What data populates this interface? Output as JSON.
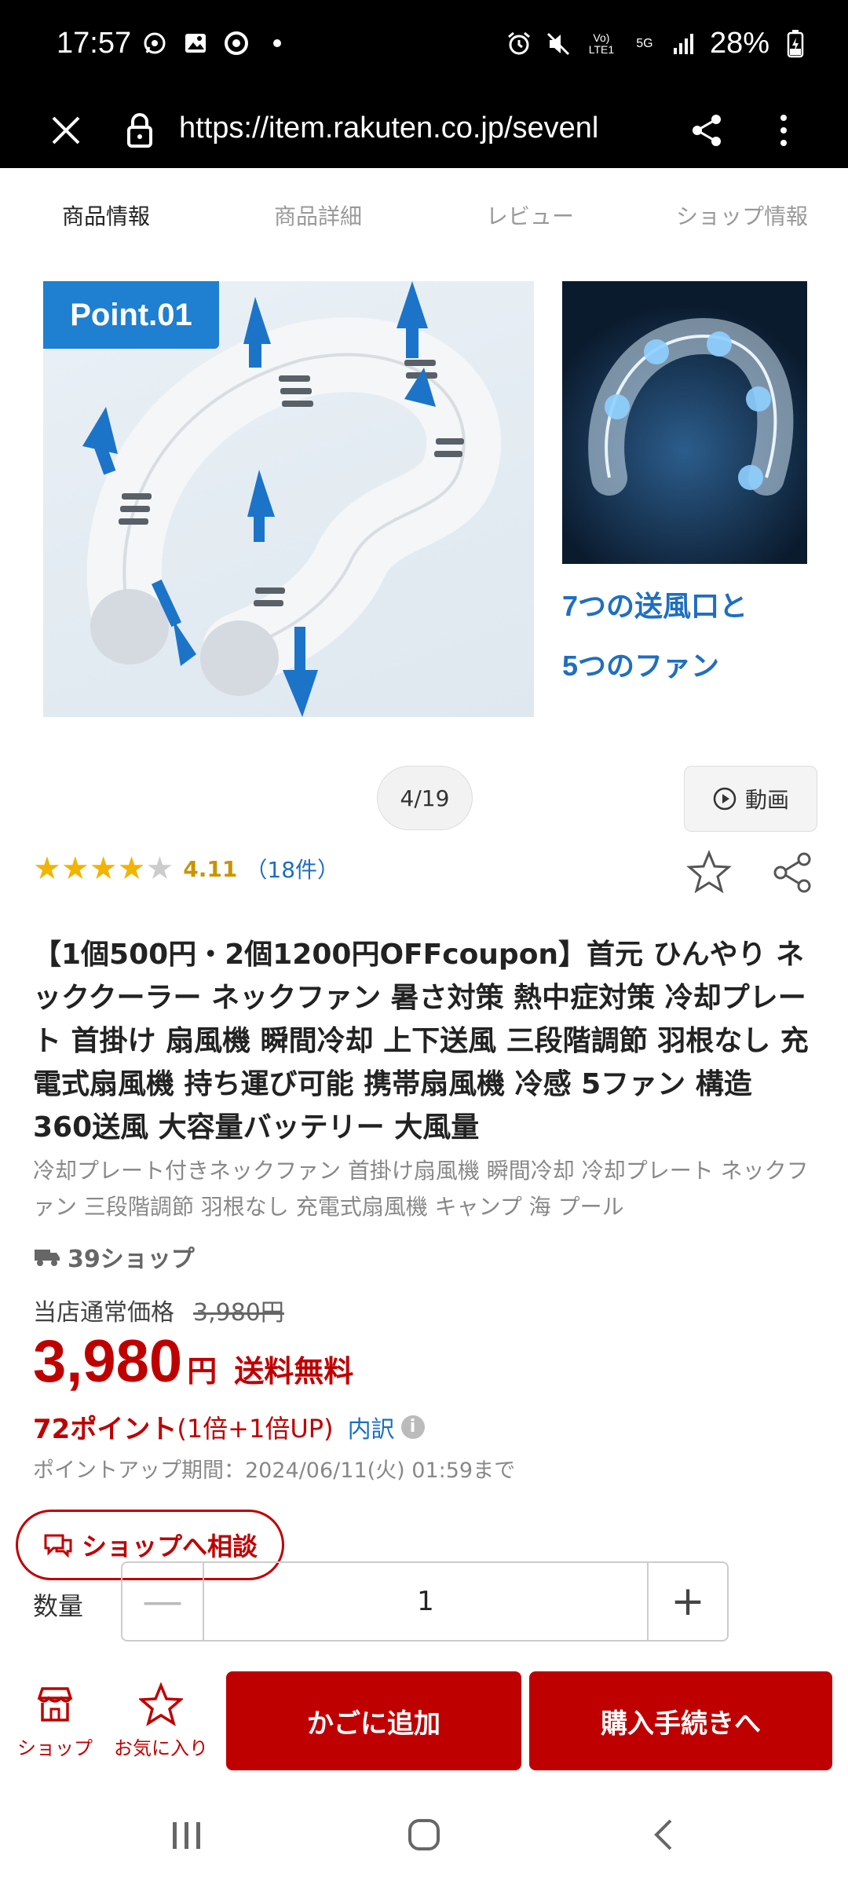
{
  "status_bar": {
    "time": "17:57",
    "battery": "28%",
    "left_icons": [
      "whatsapp-icon",
      "gallery-icon",
      "chrome-icon",
      "dot-icon"
    ],
    "right_icons": [
      "alarm-icon",
      "mute-icon",
      "volte-icon",
      "5g-icon",
      "signal-icon",
      "battery-icon"
    ]
  },
  "browser": {
    "url": "https://item.rakuten.co.jp/sevenl"
  },
  "tabs": [
    {
      "label": "商品情報",
      "active": true
    },
    {
      "label": "商品詳細",
      "active": false
    },
    {
      "label": "レビュー",
      "active": false
    },
    {
      "label": "ショップ情報",
      "active": false
    }
  ],
  "gallery": {
    "main_badge": "Point.01",
    "side_caption_line1": "7つの送風口と",
    "side_caption_line2": "5つのファン",
    "counter": "4/19",
    "video_label": "動画"
  },
  "rating": {
    "value": "4.11",
    "stars": 4.11,
    "count": "（18件）"
  },
  "product": {
    "title": "【1個500円・2個1200円OFFcoupon】首元 ひんやり ネッククーラー ネックファン 暑さ対策 熱中症対策 冷却プレート 首掛け 扇風機 瞬間冷却 上下送風 三段階調節 羽根なし 充電式扇風機 持ち運び可能 携帯扇風機 冷感 5ファン 構造 360送風 大容量バッテリー 大風量",
    "subtitle": "冷却プレート付きネックファン 首掛け扇風機 瞬間冷却 冷却プレート ネックファン 三段階調節 羽根なし 充電式扇風機 キャンプ 海 プール",
    "shop_badge": "39ショップ",
    "normal_price_label": "当店通常価格",
    "normal_price": "3,980円",
    "price": "3,980",
    "price_unit": "円",
    "shipping": "送料無料",
    "points_main": "72ポイント",
    "points_detail": "(1倍+1倍UP)",
    "points_breakdown": "内訳",
    "points_period": "ポイントアップ期間：2024/06/11(火) 01:59まで"
  },
  "consult_button": "ショップへ相談",
  "quantity": {
    "label": "数量",
    "value": "1",
    "minus": "—",
    "plus": "+"
  },
  "actions": {
    "shop_label": "ショップ",
    "fav_label": "お気に入り",
    "cart_label": "かごに追加",
    "buy_label": "購入手続きへ"
  },
  "colors": {
    "accent": "#bf0000",
    "rating_star": "#f1b400",
    "link": "#1b6ec2",
    "badge_blue": "#1f7fd0"
  }
}
